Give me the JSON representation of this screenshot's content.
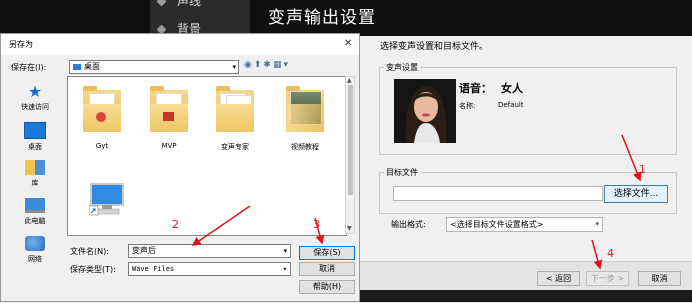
{
  "wizard": {
    "title": "变声输出设置",
    "side_items": [
      "声线",
      "背景"
    ],
    "prompt": "选择变声设置和目标文件。",
    "voice_group": {
      "label": "变声设置",
      "voice_label": "语音：",
      "voice_value": "女人",
      "name_label": "名称:",
      "name_value": "Default"
    },
    "target_group": {
      "label": "目标文件",
      "file_value": "",
      "choose_button": "选择文件..."
    },
    "format": {
      "label": "输出格式:",
      "selected": "<选择目标文件设置格式>"
    },
    "buttons": {
      "back": "< 返回",
      "next": "下一步 >",
      "cancel": "取消"
    }
  },
  "dialog": {
    "title": "另存为",
    "save_in_label": "保存在(I):",
    "save_in_value": "桌面",
    "places": [
      "快速访问",
      "桌面",
      "库",
      "此电脑",
      "网络"
    ],
    "items": [
      "Gyt",
      "MVP",
      "变声专家",
      "视频教程"
    ],
    "filename_label": "文件名(N):",
    "filename_value": "变声后",
    "filetype_label": "保存类型(T):",
    "filetype_value": "Wave Files",
    "buttons": {
      "save": "保存(S)",
      "cancel": "取消",
      "help": "帮助(H)"
    }
  },
  "annotations": [
    "1",
    "2",
    "3",
    "4"
  ],
  "colors": {
    "annotation": "#e0151b",
    "header_bg": "#0f0f0f",
    "accent": "#0078d7"
  }
}
